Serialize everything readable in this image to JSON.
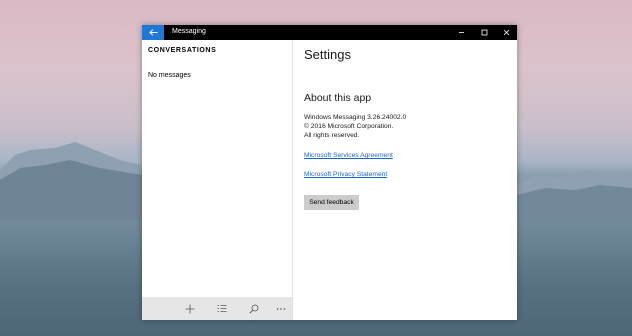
{
  "window": {
    "title": "Messaging",
    "back_icon": "back-arrow-icon",
    "controls": [
      "minimize-icon",
      "maximize-icon",
      "close-icon"
    ]
  },
  "sidebar": {
    "heading": "CONVERSATIONS",
    "empty_text": "No messages",
    "toolbar": [
      {
        "icon": "add-icon",
        "glyph": "+"
      },
      {
        "icon": "select-icon",
        "glyph": "☰"
      },
      {
        "icon": "search-icon",
        "glyph": "⌕"
      },
      {
        "icon": "more-icon",
        "glyph": "···"
      }
    ]
  },
  "settings": {
    "title": "Settings",
    "about_heading": "About this app",
    "version": "Windows Messaging 3.26.24002.0",
    "copyright": "© 2016 Microsoft Corporation.",
    "rights": "All rights reserved.",
    "services_link": "Microsoft Services Agreement",
    "privacy_link": "Microsoft Privacy Statement",
    "feedback_button": "Send feedback"
  },
  "colors": {
    "accent": "#1e78d6",
    "link": "#1e64c8",
    "titlebar": "#000000",
    "toolbar_bg": "#e6e6e6"
  }
}
